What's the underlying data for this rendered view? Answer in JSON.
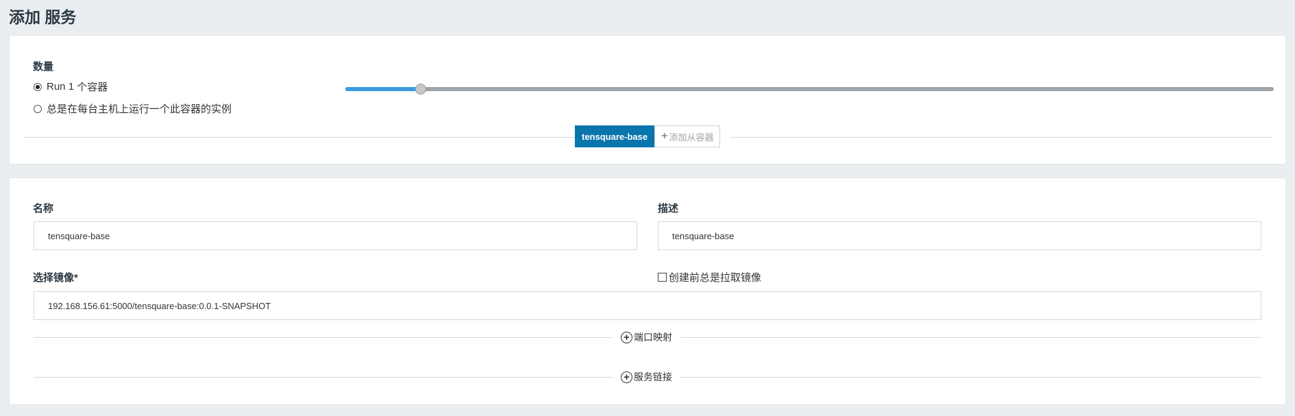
{
  "page": {
    "title": "添加 服务"
  },
  "scale": {
    "label": "数量",
    "option_run_prefix": "Run",
    "option_run_count": "1",
    "option_run_suffix": "个容器",
    "option_global": "总是在每台主机上运行一个此容器的实例",
    "selected_option": "run",
    "slider_value": 1,
    "slider_fraction": 0.081
  },
  "containers": {
    "active_tab": "tensquare-base",
    "add_sidekick": "添加从容器"
  },
  "form": {
    "name_label": "名称",
    "name_value": "tensquare-base",
    "description_label": "描述",
    "description_value": "tensquare-base",
    "image_label": "选择镜像*",
    "image_value": "192.168.156.61:5000/tensquare-base:0.0.1-SNAPSHOT",
    "always_pull_label": "创建前总是拉取镜像",
    "always_pull_checked": false
  },
  "sections": {
    "port_mapping": "端口映射",
    "service_links": "服务链接"
  },
  "colors": {
    "accent": "#0a75ad",
    "slider_fill": "#3b9ae1",
    "background": "#ebeef0"
  }
}
